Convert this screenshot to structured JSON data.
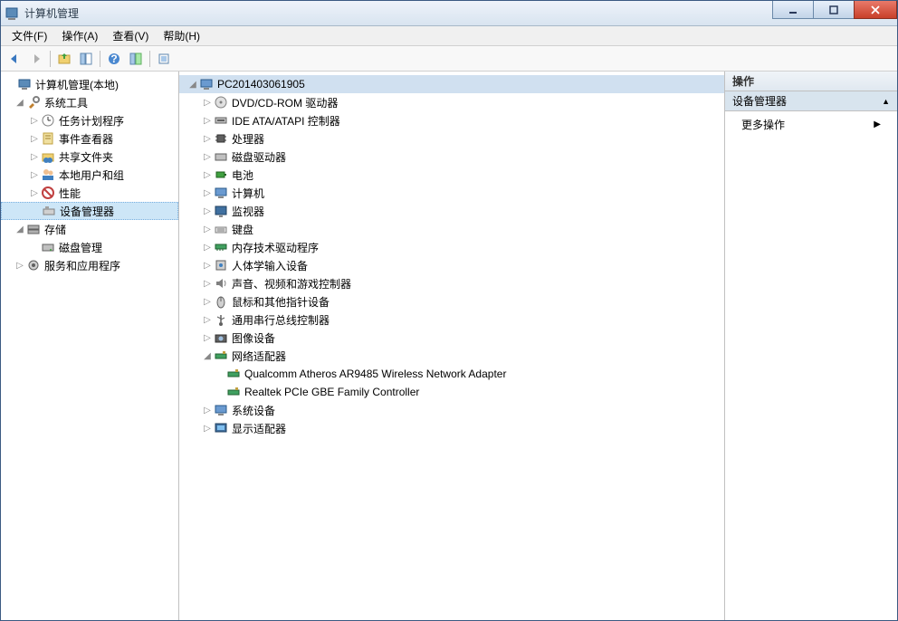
{
  "window": {
    "title": "计算机管理"
  },
  "menu": {
    "file": "文件(F)",
    "action": "操作(A)",
    "view": "查看(V)",
    "help": "帮助(H)"
  },
  "leftTree": {
    "root": "计算机管理(本地)",
    "sysTools": "系统工具",
    "taskSched": "任务计划程序",
    "eventViewer": "事件查看器",
    "sharedFolders": "共享文件夹",
    "localUsers": "本地用户和组",
    "performance": "性能",
    "deviceMgr": "设备管理器",
    "storage": "存储",
    "diskMgmt": "磁盘管理",
    "services": "服务和应用程序"
  },
  "devTree": {
    "computer": "PC201403061905",
    "dvd": "DVD/CD-ROM 驱动器",
    "ide": "IDE ATA/ATAPI 控制器",
    "processors": "处理器",
    "diskDrives": "磁盘驱动器",
    "batteries": "电池",
    "computers": "计算机",
    "monitors": "监视器",
    "keyboards": "键盘",
    "memTech": "内存技术驱动程序",
    "hid": "人体学输入设备",
    "sound": "声音、视频和游戏控制器",
    "mice": "鼠标和其他指针设备",
    "usb": "通用串行总线控制器",
    "imaging": "图像设备",
    "network": "网络适配器",
    "net1": "Qualcomm Atheros AR9485 Wireless Network Adapter",
    "net2": "Realtek PCIe GBE Family Controller",
    "system": "系统设备",
    "display": "显示适配器"
  },
  "actions": {
    "header": "操作",
    "section": "设备管理器",
    "more": "更多操作"
  }
}
